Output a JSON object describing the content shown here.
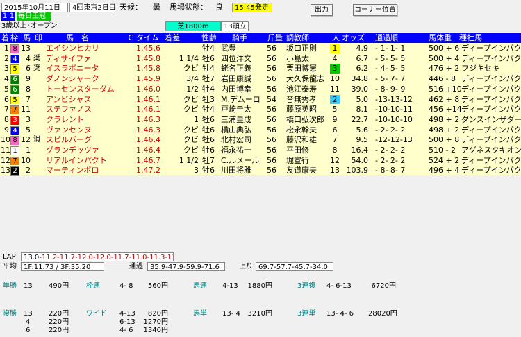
{
  "header": {
    "date": "2015年10月11日",
    "meet": "4回東京2日目",
    "weather_label": "天候：",
    "weather": "曇",
    "track_label": "馬場状態：",
    "track": "良",
    "post_time": "15:45発走",
    "output_button": "出力",
    "corner_button": "コーナー位置",
    "race_no": "１１Ｒ",
    "race_name": "毎日王冠",
    "condition": "3歳以上･オープン",
    "course": "芝1800m",
    "runners": "13頭立"
  },
  "columns": {
    "arrival": "着",
    "waku": "枠",
    "umaban": "馬",
    "mark": "印",
    "horse": "馬　名",
    "time_idx": "Ｃ",
    "time": "タイム",
    "margin": "着差",
    "sex_age": "性齢",
    "jockey": "騎手",
    "weight": "斤量",
    "trainer": "調教師",
    "pop": "人",
    "odds": "オッズ",
    "passing": "通過順",
    "body_weight": "馬体重",
    "sire": "種牡馬"
  },
  "rows": [
    {
      "arr": "1",
      "waku": "8",
      "num": "13",
      "mark": "",
      "horse": "エイシンヒカリ",
      "time": "1.45.6",
      "margin": "",
      "sex": "牡4",
      "jockey": "武豊",
      "wt": "56",
      "trainer": "坂口正則",
      "pop": "1",
      "odds": "4.9",
      "pass": "- 1- 1- 1",
      "bw": "500 + 6",
      "sire": "ディープインパクト"
    },
    {
      "arr": "2",
      "waku": "4",
      "num": "4",
      "mark": "奨",
      "horse": "ディサイファ",
      "time": "1.45.8",
      "margin": "1 1/4",
      "sex": "牡6",
      "jockey": "四位洋文",
      "wt": "56",
      "trainer": "小島太",
      "pop": "4",
      "odds": "6.7",
      "pass": "- 5- 5- 5",
      "bw": "500 + 4",
      "sire": "ディープインパクト"
    },
    {
      "arr": "3",
      "waku": "5",
      "num": "6",
      "mark": "奨",
      "horse": "イスラボニータ",
      "time": "1.45.8",
      "margin": "クビ",
      "sex": "牡4",
      "jockey": "蛯名正義",
      "wt": "56",
      "trainer": "栗田博憲",
      "pop": "3",
      "odds": "6.2",
      "pass": "- 4- 5- 5",
      "bw": "476 + 2",
      "sire": "フジキセキ"
    },
    {
      "arr": "4",
      "waku": "6",
      "num": "9",
      "mark": "",
      "horse": "ダノンシャーク",
      "time": "1.45.9",
      "margin": "3/4",
      "sex": "牡7",
      "jockey": "岩田康誠",
      "wt": "56",
      "trainer": "大久保龍志",
      "pop": "10",
      "odds": "34.8",
      "pass": "- 5- 7- 7",
      "bw": "446 - 8",
      "sire": "ディープインパクト"
    },
    {
      "arr": "5",
      "waku": "6",
      "num": "8",
      "mark": "",
      "horse": "トーセンスターダム",
      "time": "1.46.0",
      "margin": "1/2",
      "sex": "牡4",
      "jockey": "内田博幸",
      "wt": "56",
      "trainer": "池江泰寿",
      "pop": "11",
      "odds": "39.0",
      "pass": "- 8- 9- 9",
      "bw": "516 +10",
      "sire": "ディープインパクト"
    },
    {
      "arr": "6",
      "waku": "5",
      "num": "7",
      "mark": "",
      "horse": "アンビシャス",
      "time": "1.46.1",
      "margin": "クビ",
      "sex": "牡3",
      "jockey": "M.デムーロ",
      "wt": "54",
      "trainer": "音無秀孝",
      "pop": "2",
      "odds": "5.0",
      "pass": "-13-13-12",
      "bw": "462 + 8",
      "sire": "ディープインパクト"
    },
    {
      "arr": "7",
      "waku": "7",
      "num": "11",
      "mark": "",
      "horse": "ステファノス",
      "time": "1.46.1",
      "margin": "クビ",
      "sex": "牡4",
      "jockey": "戸崎圭太",
      "wt": "56",
      "trainer": "藤原英昭",
      "pop": "5",
      "odds": "8.1",
      "pass": "-10-10-11",
      "bw": "456 +14",
      "sire": "ディープインパクト"
    },
    {
      "arr": "8",
      "waku": "3",
      "num": "3",
      "mark": "",
      "horse": "クラレント",
      "time": "1.46.3",
      "margin": "1",
      "sex": "牡6",
      "jockey": "三浦皇成",
      "wt": "56",
      "trainer": "橋口弘次郎",
      "pop": "9",
      "odds": "22.7",
      "pass": "-10-10-10",
      "bw": "498 + 2",
      "sire": "ダンスインザダーク"
    },
    {
      "arr": "9",
      "waku": "4",
      "num": "5",
      "mark": "",
      "horse": "ヴァンセンヌ",
      "time": "1.46.3",
      "margin": "クビ",
      "sex": "牡6",
      "jockey": "横山典弘",
      "wt": "56",
      "trainer": "松永幹夫",
      "pop": "6",
      "odds": "5.6",
      "pass": "- 2- 2- 2",
      "bw": "498 + 2",
      "sire": "ディープインパクト"
    },
    {
      "arr": "10",
      "waku": "8",
      "num": "12",
      "mark": "消",
      "horse": "スピルバーグ",
      "time": "1.46.4",
      "margin": "クビ",
      "sex": "牡6",
      "jockey": "北村宏司",
      "wt": "56",
      "trainer": "藤沢和雄",
      "pop": "7",
      "odds": "9.5",
      "pass": "-12-12-13",
      "bw": "500 + 8",
      "sire": "ディープインパクト"
    },
    {
      "arr": "11",
      "waku": "1",
      "num": "1",
      "mark": "",
      "horse": "グランデッツァ",
      "time": "1.46.4",
      "margin": "クビ",
      "sex": "牡6",
      "jockey": "福永祐一",
      "wt": "56",
      "trainer": "平田修",
      "pop": "8",
      "odds": "16.4",
      "pass": "- 2- 2- 2",
      "bw": "510 - 2",
      "sire": "アグネスタキオン"
    },
    {
      "arr": "12",
      "waku": "7",
      "num": "10",
      "mark": "",
      "horse": "リアルインパクト",
      "time": "1.46.7",
      "margin": "1 1/2",
      "sex": "牡7",
      "jockey": "C.ルメール",
      "wt": "56",
      "trainer": "堀宣行",
      "pop": "12",
      "odds": "54.0",
      "pass": "- 2- 2- 2",
      "bw": "524 + 2",
      "sire": "ディープインパクト"
    },
    {
      "arr": "13",
      "waku": "2",
      "num": "2",
      "mark": "",
      "horse": "マーティンボロ",
      "time": "1.47.2",
      "margin": "3",
      "sex": "牡6",
      "jockey": "川田将雅",
      "wt": "56",
      "trainer": "友道康夫",
      "pop": "13",
      "odds": "103.9",
      "pass": "- 8- 8- 7",
      "bw": "496 + 4",
      "sire": "ディープインパクト"
    }
  ],
  "summary": {
    "lap_label": "LAP",
    "lap": "13.0-11.2-11.7-12.0-12.0-11.7-11.0-11.3-11.7",
    "avg_label": "平均",
    "avg": "1F:11.73 / 3F:35.20",
    "passing_label": "通過",
    "passing": "35.9-47.9-59.9-71.6",
    "agari_label": "上り",
    "agari": "69.7-57.7-45.7-34.0"
  },
  "payouts": {
    "tansho_label": "単勝",
    "tansho_num": "13",
    "tansho_pay": "490円",
    "wakuren_label": "枠連",
    "wakuren_num": "4- 8",
    "wakuren_pay": "560円",
    "umaren_label": "馬連",
    "umaren_num": "4-13",
    "umaren_pay": "1880円",
    "sanrenpuku_label": "3連複",
    "sanrenpuku_num": "4- 6-13",
    "sanrenpuku_pay": "6720円",
    "fukusho_label": "複勝",
    "fukusho": [
      {
        "num": "13",
        "pay": "220円"
      },
      {
        "num": "4",
        "pay": "220円"
      },
      {
        "num": "6",
        "pay": "220円"
      }
    ],
    "wide_label": "ワイド",
    "wide": [
      {
        "num": "4-13",
        "pay": "820円"
      },
      {
        "num": "6-13",
        "pay": "1270円"
      },
      {
        "num": "4- 6",
        "pay": "1340円"
      }
    ],
    "umatan_label": "馬単",
    "umatan_num": "13- 4",
    "umatan_pay": "3210円",
    "sanrentan_label": "3連単",
    "sanrentan_num": "13- 4- 6",
    "sanrentan_pay": "28020円"
  },
  "waku_colors": {
    "1": {
      "bg": "#ffffff",
      "fg": "#000000"
    },
    "2": {
      "bg": "#000000",
      "fg": "#ffffff"
    },
    "3": {
      "bg": "#ff0000",
      "fg": "#ffffff"
    },
    "4": {
      "bg": "#0000ff",
      "fg": "#ffffff"
    },
    "5": {
      "bg": "#ffff00",
      "fg": "#000000"
    },
    "6": {
      "bg": "#008000",
      "fg": "#ffffff"
    },
    "7": {
      "bg": "#ff8000",
      "fg": "#000000"
    },
    "8": {
      "bg": "#ff66cc",
      "fg": "#000000"
    }
  },
  "pop_highlight": {
    "1": "#ffff00",
    "2": "#33ccff",
    "3": "#00cc00"
  }
}
